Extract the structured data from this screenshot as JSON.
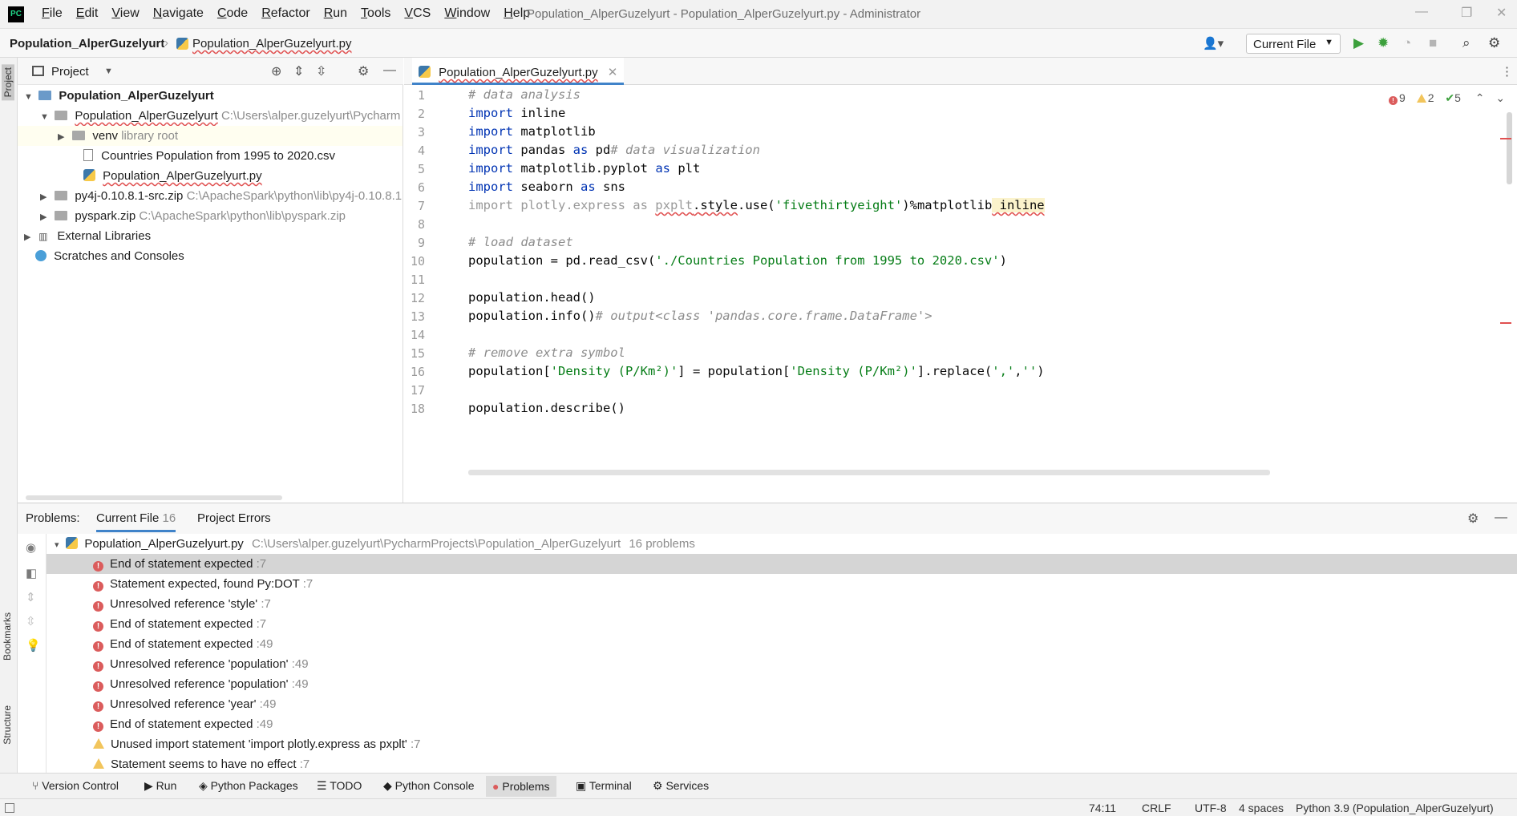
{
  "window": {
    "app_icon": "pycharm-logo",
    "title": "Population_AlperGuzelyurt - Population_AlperGuzelyurt.py - Administrator",
    "controls": [
      "—",
      "❐",
      "✕"
    ]
  },
  "menu": [
    "File",
    "Edit",
    "View",
    "Navigate",
    "Code",
    "Refactor",
    "Run",
    "Tools",
    "VCS",
    "Window",
    "Help"
  ],
  "navbar": {
    "project": "Population_AlperGuzelyurt",
    "file": "Population_AlperGuzelyurt.py",
    "run_config": "Current File"
  },
  "left_stripe": [
    "Project",
    "Bookmarks",
    "Structure"
  ],
  "project_panel": {
    "title": "Project",
    "tree": [
      {
        "label": "Population_AlperGuzelyurt",
        "hint": ""
      },
      {
        "label": "Population_AlperGuzelyurt",
        "hint": "C:\\Users\\alper.guzelyurt\\Pycharm"
      },
      {
        "label": "venv",
        "hint": "library root"
      },
      {
        "label": "Countries Population from 1995 to 2020.csv",
        "hint": ""
      },
      {
        "label": "Population_AlperGuzelyurt.py",
        "hint": ""
      },
      {
        "label": "py4j-0.10.8.1-src.zip",
        "hint": "C:\\ApacheSpark\\python\\lib\\py4j-0.10.8.1"
      },
      {
        "label": "pyspark.zip",
        "hint": "C:\\ApacheSpark\\python\\lib\\pyspark.zip"
      },
      {
        "label": "External Libraries",
        "hint": ""
      },
      {
        "label": "Scratches and Consoles",
        "hint": ""
      }
    ]
  },
  "editor": {
    "tab": "Population_AlperGuzelyurt.py",
    "inspections": {
      "errors": "9",
      "warnings": "2",
      "weak": "5"
    },
    "line_numbers": [
      "1",
      "2",
      "3",
      "4",
      "5",
      "6",
      "7",
      "8",
      "9",
      "10",
      "11",
      "12",
      "13",
      "14",
      "15",
      "16",
      "17",
      "18"
    ],
    "code": {
      "l1": "# data analysis",
      "l2_kw": "import",
      "l2": " inline",
      "l3_kw": "import",
      "l3": " matplotlib",
      "l4_kw": "import",
      "l4a": " pandas ",
      "l4_as": "as",
      "l4b": " pd",
      "l4_cm": "# data visualization",
      "l5_kw": "import",
      "l5a": " matplotlib.pyplot ",
      "l5_as": "as",
      "l5b": " plt",
      "l6_kw": "import",
      "l6a": " seaborn ",
      "l6_as": "as",
      "l6b": " sns",
      "l7a": "import plotly.express as ",
      "l7b": "pxplt",
      "l7c": ".",
      "l7d": "style",
      "l7e": ".use(",
      "l7_str": "'fivethirtyeight'",
      "l7f": ")%matplotlib",
      "l7g": " inline",
      "l9": "# load dataset",
      "l10a": "population = pd.read_csv(",
      "l10_str": "'./Countries Population from 1995 to 2020.csv'",
      "l10b": ")",
      "l12": "population.head()",
      "l13a": "population.info()",
      "l13_cm": "# output<class 'pandas.core.frame.DataFrame'>",
      "l15": "# remove extra symbol",
      "l16a": "population[",
      "l16_s1": "'Density (P/Km²)'",
      "l16b": "] = population[",
      "l16_s2": "'Density (P/Km²)'",
      "l16c": "].replace(",
      "l16_s3": "','",
      "l16d": ",",
      "l16_s4": "''",
      "l16e": ")",
      "l18": "population.describe()"
    }
  },
  "problems": {
    "label": "Problems:",
    "tabs": [
      {
        "label": "Current File",
        "count": "16"
      },
      {
        "label": "Project Errors",
        "count": ""
      }
    ],
    "file": {
      "name": "Population_AlperGuzelyurt.py",
      "path": "C:\\Users\\alper.guzelyurt\\PycharmProjects\\Population_AlperGuzelyurt",
      "count": "16 problems"
    },
    "items": [
      {
        "severity": "error",
        "text": "End of statement expected",
        "line": ":7"
      },
      {
        "severity": "error",
        "text": "Statement expected, found Py:DOT",
        "line": ":7"
      },
      {
        "severity": "error",
        "text": "Unresolved reference 'style'",
        "line": ":7"
      },
      {
        "severity": "error",
        "text": "End of statement expected",
        "line": ":7"
      },
      {
        "severity": "error",
        "text": "End of statement expected",
        "line": ":49"
      },
      {
        "severity": "error",
        "text": "Unresolved reference 'population'",
        "line": ":49"
      },
      {
        "severity": "error",
        "text": "Unresolved reference 'population'",
        "line": ":49"
      },
      {
        "severity": "error",
        "text": "Unresolved reference 'year'",
        "line": ":49"
      },
      {
        "severity": "error",
        "text": "End of statement expected",
        "line": ":49"
      },
      {
        "severity": "warning",
        "text": "Unused import statement 'import plotly.express as pxplt'",
        "line": ":7"
      },
      {
        "severity": "warning",
        "text": "Statement seems to have no effect",
        "line": ":7"
      }
    ]
  },
  "tool_windows": [
    "Version Control",
    "Run",
    "Python Packages",
    "TODO",
    "Python Console",
    "Problems",
    "Terminal",
    "Services"
  ],
  "status": {
    "position": "74:11",
    "line_sep": "CRLF",
    "encoding": "UTF-8",
    "indent": "4 spaces",
    "interpreter": "Python 3.9 (Population_AlperGuzelyurt)"
  }
}
